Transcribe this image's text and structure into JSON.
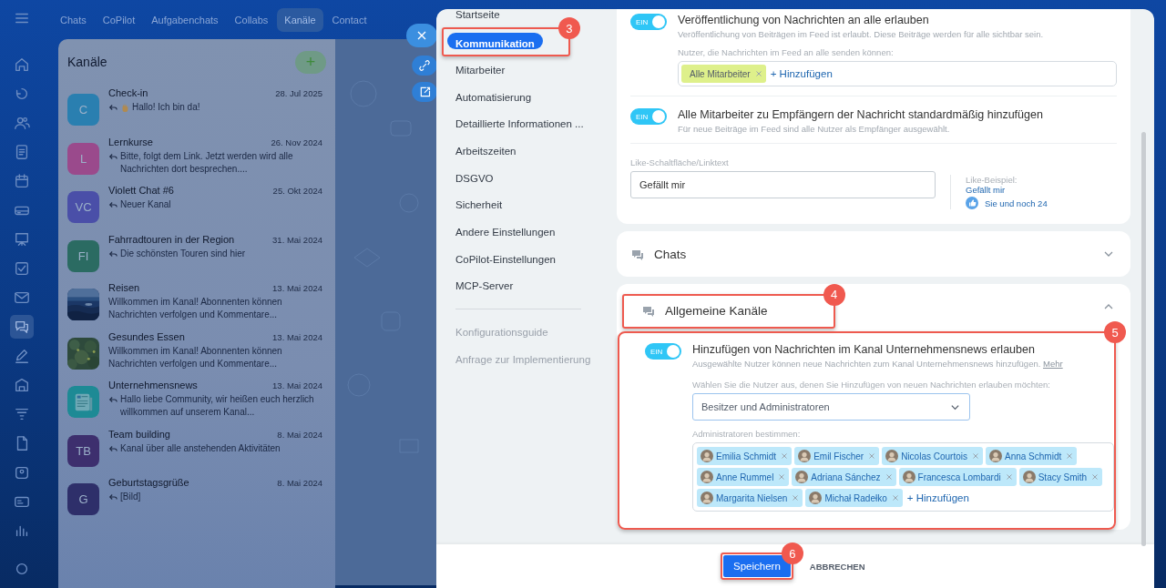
{
  "rail": [
    {
      "selected": false
    },
    {
      "selected": false
    },
    {
      "selected": false
    },
    {
      "selected": false
    },
    {
      "selected": false
    },
    {
      "selected": false
    },
    {
      "selected": false
    },
    {
      "selected": false
    },
    {
      "selected": false
    },
    {
      "selected": false
    },
    {
      "selected": true
    },
    {
      "selected": false
    },
    {
      "selected": false
    },
    {
      "selected": false
    },
    {
      "selected": false
    },
    {
      "selected": false
    },
    {
      "selected": false
    },
    {
      "selected": false
    },
    {
      "selected": false
    }
  ],
  "top_tabs": [
    {
      "label": "Chats",
      "selected": false
    },
    {
      "label": "CoPilot",
      "selected": false
    },
    {
      "label": "Aufgabenchats",
      "selected": false
    },
    {
      "label": "Collabs",
      "selected": false
    },
    {
      "label": "Kanäle",
      "selected": true
    },
    {
      "label": "Contact",
      "selected": false
    }
  ],
  "channel_list": {
    "title": "Kanäle",
    "add": "+",
    "items": [
      {
        "avatar": {
          "kind": "letters",
          "text": "C",
          "color": "#2a7fb0"
        },
        "name": "Check-in",
        "date": "28. Jul 2025",
        "reply": true,
        "wave": true,
        "preview": "Hallo! Ich bin da!"
      },
      {
        "avatar": {
          "kind": "letters",
          "text": "L",
          "color": "#9a4a8c"
        },
        "name": "Lernkurse",
        "date": "26. Nov 2024",
        "reply": true,
        "wave": false,
        "preview": "Bitte, folgt dem Link. Jetzt werden wird alle Nachrichten dort besprechen...."
      },
      {
        "avatar": {
          "kind": "letters",
          "text": "VC",
          "color": "#4a4fa8"
        },
        "name": "Violett Chat #6",
        "date": "25. Okt 2024",
        "reply": true,
        "wave": false,
        "preview": "Neuer Kanal"
      },
      {
        "avatar": {
          "kind": "letters",
          "text": "FI",
          "color": "#2b6b62"
        },
        "name": "Fahrradtouren in der Region",
        "date": "31. Mai 2024",
        "reply": true,
        "wave": false,
        "preview": "Die schönsten Touren sind hier"
      },
      {
        "name": "Reisen",
        "date": "13. Mai 2024",
        "reply": false,
        "wave": false,
        "preview": "Willkommen im Kanal! Abonnenten können Nachrichten verfolgen und Kommentare..."
      },
      {
        "name": "Gesundes Essen",
        "date": "13. Mai 2024",
        "reply": false,
        "wave": false,
        "preview": "Willkommen im Kanal! Abonnenten können Nachrichten verfolgen und Kommentare..."
      },
      {
        "avatar": {
          "kind": "icon",
          "color": "#1d8a95"
        },
        "name": "Unternehmensnews",
        "date": "13. Mai 2024",
        "reply": true,
        "wave": false,
        "preview": "Hallo liebe Community, wir heißen euch herzlich willkommen auf unserem Kanal..."
      },
      {
        "avatar": {
          "kind": "letters",
          "text": "TB",
          "color": "#3d2f6e"
        },
        "name": "Team building",
        "date": "8. Mai 2024",
        "reply": true,
        "wave": false,
        "preview": "Kanal über alle anstehenden Aktivitäten"
      },
      {
        "avatar": {
          "kind": "letters",
          "text": "G",
          "color": "#2e2f6a"
        },
        "name": "Geburtstagsgrüße",
        "date": "8. Mai 2024",
        "reply": true,
        "wave": false,
        "preview": "[Bild]"
      }
    ]
  },
  "settings_nav": [
    {
      "label": "Startseite",
      "kind": "item",
      "selected": false
    },
    {
      "label": "Kommunikation",
      "kind": "item",
      "selected": true,
      "callout": "3"
    },
    {
      "label": "Mitarbeiter",
      "kind": "item",
      "selected": false
    },
    {
      "label": "Automatisierung",
      "kind": "item",
      "selected": false
    },
    {
      "label": "Detaillierte Informationen ...",
      "kind": "item",
      "selected": false
    },
    {
      "label": "Arbeitszeiten",
      "kind": "item",
      "selected": false
    },
    {
      "label": "DSGVO",
      "kind": "item",
      "selected": false
    },
    {
      "label": "Sicherheit",
      "kind": "item",
      "selected": false
    },
    {
      "label": "Andere Einstellungen",
      "kind": "item",
      "selected": false
    },
    {
      "label": "CoPilot-Einstellungen",
      "kind": "item",
      "selected": false
    },
    {
      "label": "MCP-Server",
      "kind": "item",
      "selected": false
    },
    {
      "label": "Konfigurationsguide",
      "kind": "link",
      "selected": false
    },
    {
      "label": "Anfrage zur Implementierung",
      "kind": "link",
      "selected": false
    }
  ],
  "feed_card": {
    "toggles": [
      {
        "on": true,
        "switch_label": "EIN",
        "title": "Veröffentlichung von Nachrichten an alle erlauben",
        "description": "Veröffentlichung von Beiträgen im Feed ist erlaubt. Diese Beiträge werden für alle sichtbar sein.",
        "field_label": "Nutzer, die Nachrichten im Feed an alle senden können:",
        "tags": [
          {
            "text": "Alle Mitarbeiter",
            "kind": "group"
          }
        ],
        "add": "+ Hinzufügen"
      },
      {
        "on": true,
        "switch_label": "EIN",
        "title": "Alle Mitarbeiter zu Empfängern der Nachricht standardmäßig hinzufügen",
        "description": "Für neue Beiträge im Feed sind alle Nutzer als Empfänger ausgewählt."
      }
    ],
    "like": {
      "label": "Like-Schaltfläche/Linktext",
      "value": "Gefällt mir",
      "example_label": "Like-Beispiel:",
      "example_link": "Gefällt mir",
      "example_count": "Sie und noch 24"
    }
  },
  "sections": [
    {
      "title": "Chats",
      "expanded": false
    },
    {
      "title": "Allgemeine Kanäle",
      "expanded": true,
      "callout": "4",
      "body_callout": "5",
      "toggle": {
        "on": true,
        "switch_label": "EIN",
        "title": "Hinzufügen von Nachrichten im Kanal Unternehmensnews erlauben",
        "description": "Ausgewählte Nutzer können neue Nachrichten zum Kanal Unternehmensnews hinzufügen.",
        "more": "Mehr"
      },
      "select_label": "Wählen Sie die Nutzer aus, denen Sie Hinzufügen von neuen Nachrichten erlauben möchten:",
      "select_value": "Besitzer und Administratoren",
      "admins_label": "Administratoren bestimmen:",
      "admins": [
        {
          "text": "Emilia Schmidt",
          "kind": "user"
        },
        {
          "text": "Emil Fischer",
          "kind": "user"
        },
        {
          "text": "Nicolas Courtois",
          "kind": "user"
        },
        {
          "text": "Anna Schmidt",
          "kind": "user"
        },
        {
          "text": "Anne Rummel",
          "kind": "user"
        },
        {
          "text": "Adriana Sánchez",
          "kind": "user"
        },
        {
          "text": "Francesca Lombardi",
          "kind": "user"
        },
        {
          "text": "Stacy Smith",
          "kind": "user"
        },
        {
          "text": "Margarita Nielsen",
          "kind": "user"
        },
        {
          "text": "Michał Radełko",
          "kind": "user"
        }
      ],
      "add": "+ Hinzufügen"
    }
  ],
  "footer": {
    "save": "Speichern",
    "save_callout": "6",
    "cancel": "ABBRECHEN"
  }
}
